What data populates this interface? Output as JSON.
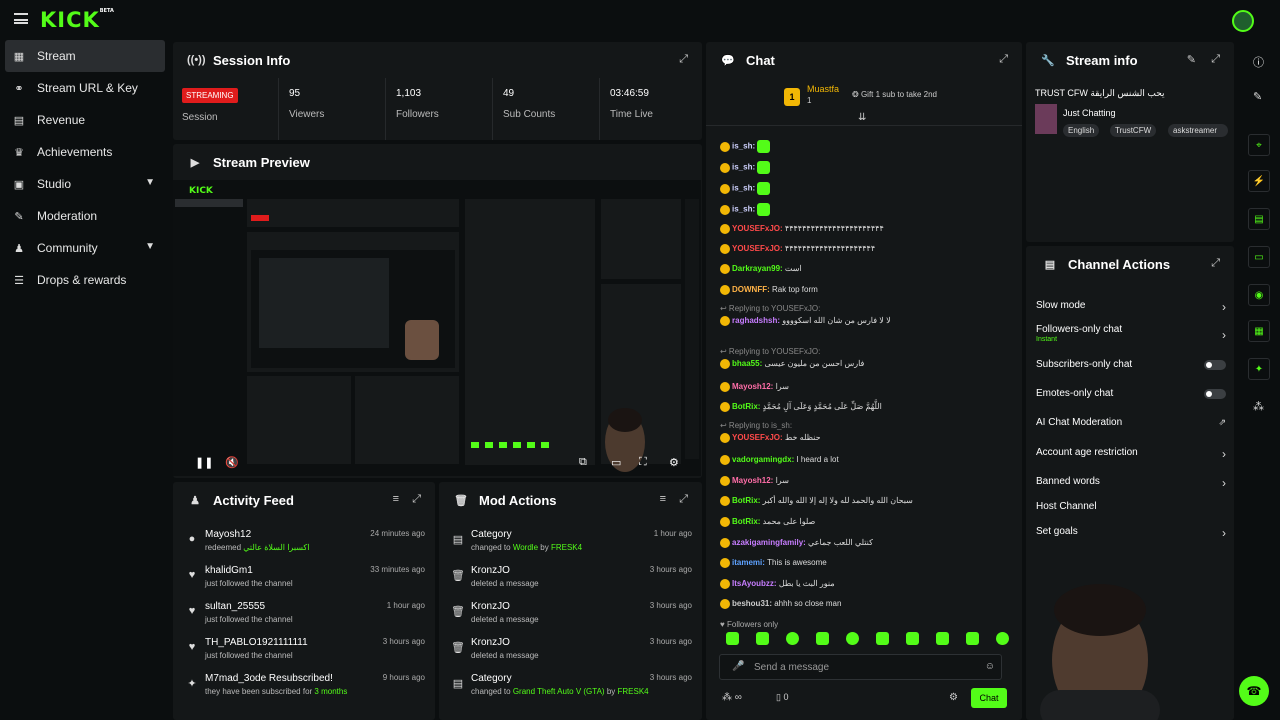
{
  "topbar": {
    "logo": "KICK",
    "beta": "BETA"
  },
  "sidebar": {
    "items": [
      {
        "label": "Stream",
        "icon": "stream-icon",
        "active": true
      },
      {
        "label": "Stream URL & Key",
        "icon": "link-icon"
      },
      {
        "label": "Revenue",
        "icon": "revenue-icon"
      },
      {
        "label": "Achievements",
        "icon": "trophy-icon"
      },
      {
        "label": "Studio",
        "icon": "studio-icon",
        "expand": true
      },
      {
        "label": "Moderation",
        "icon": "moderation-icon"
      },
      {
        "label": "Community",
        "icon": "community-icon",
        "expand": true
      },
      {
        "label": "Drops & rewards",
        "icon": "drops-icon"
      }
    ]
  },
  "session": {
    "title": "Session Info",
    "badge": "STREAMING",
    "session_label": "Session",
    "stats": [
      {
        "value": "95",
        "label": "Viewers"
      },
      {
        "value": "1,103",
        "label": "Followers"
      },
      {
        "value": "49",
        "label": "Sub Counts"
      },
      {
        "value": "03:46:59",
        "label": "Time Live"
      }
    ]
  },
  "preview": {
    "title": "Stream Preview"
  },
  "activity": {
    "title": "Activity Feed",
    "rows": [
      {
        "name": "Mayosh12",
        "sub": "redeemed",
        "extra": "اكسبرا السلاة عالتي",
        "time": "24 minutes ago"
      },
      {
        "name": "khalidGm1",
        "sub": "just followed the channel",
        "time": "33 minutes ago"
      },
      {
        "name": "sultan_25555",
        "sub": "just followed the channel",
        "time": "1 hour ago"
      },
      {
        "name": "TH_PABLO1921111111",
        "sub": "just followed the channel",
        "time": "3 hours ago"
      },
      {
        "name": "M7mad_3ode Resubscribed!",
        "sub": "they have been subscribed for",
        "extra": "3 months",
        "time": "9 hours ago"
      }
    ]
  },
  "mod": {
    "title": "Mod Actions",
    "rows": [
      {
        "name": "Category",
        "sub": "changed to",
        "extra": "Wordle",
        "by": "by",
        "who": "FRESK4",
        "time": "1 hour ago"
      },
      {
        "name": "KronzJO",
        "sub": "deleted a message",
        "time": "3 hours ago"
      },
      {
        "name": "KronzJO",
        "sub": "deleted a message",
        "time": "3 hours ago"
      },
      {
        "name": "KronzJO",
        "sub": "deleted a message",
        "time": "3 hours ago"
      },
      {
        "name": "Category",
        "sub": "changed to",
        "extra": "Grand Theft Auto V (GTA)",
        "by": "by",
        "who": "FRESK4",
        "time": "3 hours ago"
      }
    ]
  },
  "chat": {
    "title": "Chat",
    "top_name": "Muastfa",
    "top_count": "1",
    "gift": "Gift 1 sub to take 2nd",
    "messages": [
      {
        "user": "is_sh",
        "text": "",
        "color": "#cfd2ff"
      },
      {
        "user": "is_sh",
        "text": "",
        "color": "#cfd2ff"
      },
      {
        "user": "is_sh",
        "text": "",
        "color": "#cfd2ff"
      },
      {
        "user": "is_sh",
        "text": "",
        "color": "#cfd2ff"
      },
      {
        "user": "YOUSEFxJO",
        "text": "۴۴۴۴۴۴۴۴۴۴۴۴۴۴۴۴۴۴۴۴۴۴۴",
        "color": "#ff4a4a"
      },
      {
        "user": "YOUSEFxJO",
        "text": "۴۴۴۴۴۴۴۴۴۴۴۴۴۴۴۴۴۴۴۴۴",
        "color": "#ff4a4a"
      },
      {
        "user": "Darkrayan99",
        "text": "است",
        "color": "#53fc18"
      },
      {
        "user": "DOWNFF",
        "text": "Rak top form",
        "color": "#ffb347"
      },
      {
        "user": "raghadshsh",
        "text": "لا لا فارس من شان الله اسكوووو",
        "color": "#c77dff"
      },
      {
        "user": "bhaa55",
        "text": "فارس احسن من مليون عيسى",
        "color": "#53fc18"
      },
      {
        "user": "Mayosh12",
        "text": "سرا",
        "color": "#ff6ea8"
      },
      {
        "user": "BotRix",
        "text": "اللَّهُمَّ صَلِّ عَلَى مُحَمَّدٍ وَعَلَى آلِ مُحَمَّدٍ",
        "color": "#53fc18"
      },
      {
        "user": "YOUSEFxJO",
        "text": "حنظله خط",
        "color": "#ff4a4a"
      },
      {
        "user": "vadorgamingdx",
        "text": "I heard a lot",
        "color": "#53fc18"
      },
      {
        "user": "Mayosh12",
        "text": "سرا",
        "color": "#ff6ea8"
      },
      {
        "user": "BotRix",
        "text": "سبحان الله والحمد لله ولا إله إلا الله والله أكبر",
        "color": "#53fc18"
      },
      {
        "user": "BotRix",
        "text": "صلوا على محمد",
        "color": "#53fc18"
      },
      {
        "user": "azakigamingfamily",
        "text": "كنتلي اللعب جماعي",
        "color": "#c77dff"
      },
      {
        "user": "itamemi",
        "text": "This is awesome",
        "color": "#5ea2ff"
      },
      {
        "user": "ItsAyoubzz",
        "text": "منور البث يا بطل",
        "color": "#c77dff"
      },
      {
        "user": "beshou31",
        "text": "ahhh so close man",
        "color": "#ccc"
      }
    ],
    "reply1": "Replying to YOUSEFxJO:",
    "reply2": "Replying to YOUSEFxJO:",
    "reply3": "Replying to is_sh:",
    "followers_only": "Followers only",
    "placeholder": "Send a message",
    "count": "0",
    "send": "Chat"
  },
  "streaminfo": {
    "title": "Stream info",
    "stream_title": "TRUST CFW يحب الشنس الرايقة",
    "category": "Just Chatting",
    "tags": [
      "English",
      "TrustCFW",
      "askstreamer"
    ]
  },
  "channel": {
    "title": "Channel Actions",
    "items": [
      {
        "label": "Slow mode",
        "kind": "arrow"
      },
      {
        "label": "Followers-only chat",
        "sub": "Instant",
        "kind": "arrow"
      },
      {
        "label": "Subscribers-only chat",
        "kind": "toggle"
      },
      {
        "label": "Emotes-only chat",
        "kind": "toggle"
      },
      {
        "label": "AI Chat Moderation",
        "kind": "external"
      },
      {
        "label": "Account age restriction",
        "kind": "arrow"
      },
      {
        "label": "Banned words",
        "kind": "arrow"
      },
      {
        "label": "Host Channel",
        "kind": "none"
      },
      {
        "label": "Set goals",
        "kind": "arrow"
      }
    ]
  },
  "colors": {
    "accent": "#53fc18",
    "live": "#e01c1c",
    "panel": "#141718"
  }
}
